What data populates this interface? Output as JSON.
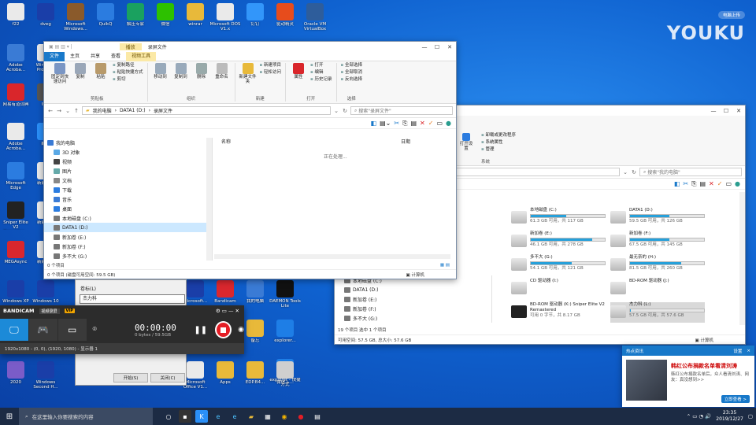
{
  "desktop": {
    "icons": [
      {
        "label": "f22",
        "icon": "document-icon",
        "color": "#eaeaea"
      },
      {
        "label": "dveg",
        "icon": "flag-icon",
        "color": "#1a3ea8"
      },
      {
        "label": "Microsoft Windows...",
        "icon": "package-icon",
        "color": "#8a5a2b"
      },
      {
        "label": "QuikQ",
        "icon": "q-app-icon",
        "color": "#2b7ce0"
      },
      {
        "label": "解压专家",
        "icon": "edge-icon",
        "color": "#1aa15f"
      },
      {
        "label": "微信",
        "icon": "wechat-icon",
        "color": "#2dc100"
      },
      {
        "label": "winrar",
        "icon": "folder-icon",
        "color": "#e8b93a"
      },
      {
        "label": "Microsoft DOS V1.x",
        "icon": "document-icon",
        "color": "#eaeaea"
      },
      {
        "label": "钉钉",
        "icon": "dingtalk-icon",
        "color": "#3296fa"
      },
      {
        "label": "驱动精灵",
        "icon": "driver-app-icon",
        "color": "#e74c1c"
      },
      {
        "label": "Oracle VM VirtualBox",
        "icon": "virtualbox-icon",
        "color": "#2e5d9b"
      },
      {
        "label": "Adobe Acroba...",
        "icon": "pc-icon",
        "color": "#3a7bd5"
      },
      {
        "label": "Windows Profes...",
        "icon": "document-icon",
        "color": "#eaeaea"
      },
      {
        "label": "网易有道词典",
        "icon": "youdao-icon",
        "color": "#d9262b"
      },
      {
        "label": "IMG",
        "icon": "image-icon",
        "color": "#555"
      },
      {
        "label": "Adobe Acroba...",
        "icon": "document-icon",
        "color": "#eaeaea"
      },
      {
        "label": "酷狗",
        "icon": "kugou-icon",
        "color": "#2a8ff7"
      },
      {
        "label": "Microsoft Edge",
        "icon": "edge-icon",
        "color": "#2b7ce0"
      },
      {
        "label": "新建文本",
        "icon": "text-file-icon",
        "color": "#eaeaea"
      },
      {
        "label": "Sniper Elite V2 Remaster...",
        "icon": "game-icon",
        "color": "#222"
      },
      {
        "label": "新建文本",
        "icon": "text-file-icon",
        "color": "#eaeaea"
      },
      {
        "label": "MEGAsync",
        "icon": "mega-icon",
        "color": "#d9272e"
      },
      {
        "label": "新建文本",
        "icon": "text-file-icon",
        "color": "#eaeaea"
      },
      {
        "label": "Windows XP",
        "icon": "flag-icon",
        "color": "#1a3ea8"
      },
      {
        "label": "Windows 10",
        "icon": "flag-icon",
        "color": "#1a3ea8"
      },
      {
        "label": "Microsoft...",
        "icon": "flag-icon",
        "color": "#1a3ea8"
      },
      {
        "label": "Bandicam",
        "icon": "bandicam-icon",
        "color": "#d9272e"
      },
      {
        "label": "我的电脑",
        "icon": "pc-icon",
        "color": "#3a7bd5"
      },
      {
        "label": "DAEMON Tools Lite",
        "icon": "daemon-icon",
        "color": "#111"
      },
      {
        "label": "explorer...",
        "icon": "ie-icon",
        "color": "#1e7ee6"
      },
      {
        "label": "备忘",
        "icon": "folder-icon",
        "color": "#e8b93a"
      },
      {
        "label": "explorer - 快捷方式",
        "icon": "ie-icon",
        "color": "#1e7ee6"
      },
      {
        "label": "2020",
        "icon": "pinwheel-icon",
        "color": "#7a5cc8"
      },
      {
        "label": "Windows Second H...",
        "icon": "flag-icon",
        "color": "#1a3ea8"
      },
      {
        "label": "Microsoft Office V1...",
        "icon": "document-icon",
        "color": "#eaeaea"
      },
      {
        "label": "Apps",
        "icon": "folder-icon",
        "color": "#e8b93a"
      },
      {
        "label": "EDP.B4...",
        "icon": "folder-icon",
        "color": "#e8b93a"
      },
      {
        "label": "微信工...",
        "icon": "tool-icon",
        "color": "#cfcfcf"
      }
    ]
  },
  "youku": {
    "badge": "电脑上传",
    "logo": "YOUKU"
  },
  "explorer_front": {
    "context_tab": "播放",
    "title": "录屏文件",
    "tabs": [
      "文件",
      "主页",
      "共享",
      "查看",
      "视频工具"
    ],
    "ribbon": {
      "clipboard": {
        "name": "剪贴板",
        "pin": "固定到快速访问",
        "copy": "复制",
        "paste": "粘贴",
        "cut": "剪切",
        "copy_path": "复制路径",
        "paste_shortcut": "粘贴快捷方式"
      },
      "organize": {
        "name": "组织",
        "move": "移动到",
        "copyto": "复制到",
        "delete": "删除",
        "rename": "重命名"
      },
      "new": {
        "name": "新建",
        "folder": "新建文件夹",
        "item": "新建项目",
        "easy": "轻松访问"
      },
      "open": {
        "name": "打开",
        "props": "属性",
        "open": "打开",
        "edit": "编辑",
        "history": "历史记录"
      },
      "select": {
        "name": "选择",
        "all": "全部选择",
        "none": "全部取消",
        "invert": "反向选择"
      }
    },
    "breadcrumb": [
      "我的电脑",
      "DATA1 (D:)",
      "录屏文件"
    ],
    "search_placeholder": "搜索\"录屏文件\"",
    "nav_items": [
      "我的电脑",
      "3D 对象",
      "视频",
      "图片",
      "文档",
      "下载",
      "音乐",
      "桌面",
      "本地磁盘 (C:)",
      "DATA1 (D:)",
      "新加卷 (E:)",
      "新加卷 (F:)",
      "多不大 (G:)"
    ],
    "col_name": "名称",
    "col_date": "日期",
    "processing": "正在处理...",
    "status": "0 个项目",
    "status2": "0 个项目 (磁盘可用空间: 59.5 GB)",
    "status_right": "计算机"
  },
  "explorer_back": {
    "ribbon_items": {
      "uninstall": "卸载或更改程序",
      "sysprops": "系统属性",
      "manage": "管理",
      "open_settings": "打开设置",
      "group": "系统"
    },
    "search_placeholder": "搜索\"我的电脑\"",
    "drives": [
      {
        "name": "本地磁盘 (C:)",
        "free": "61.3 GB 可用，共 117 GB",
        "fill": 0.48
      },
      {
        "name": "DATA1 (D:)",
        "free": "59.5 GB 可用，共 126 GB",
        "fill": 0.53
      },
      {
        "name": "新加卷 (E:)",
        "free": "46.1 GB 可用，共 278 GB",
        "fill": 0.83
      },
      {
        "name": "新加卷 (F:)",
        "free": "67.5 GB 可用，共 145 GB",
        "fill": 0.53
      },
      {
        "name": "多不大 (G:)",
        "free": "54.1 GB 可用，共 121 GB",
        "fill": 0.55
      },
      {
        "name": "最无奈的 (H:)",
        "free": "81.5 GB 可用，共 260 GB",
        "fill": 0.69
      },
      {
        "name": "CD 驱动器 (I:)",
        "free": "",
        "fill": 0
      },
      {
        "name": "BD-ROM 驱动器 (J:)",
        "free": "",
        "fill": 0
      },
      {
        "name": "BD-ROM 驱动器 (K:) Sniper Elite V2 Remastered",
        "free": "可用 0 字节，共 8.17 GB",
        "fill": 0
      },
      {
        "name": "杰力科 (L:)",
        "free": "57.5 GB 可用，共 57.6 GB",
        "fill": 0.01
      }
    ],
    "nav_items": [
      "本地磁盘 (C:)",
      "DATA1 (D:)",
      "新加卷 (E:)",
      "新加卷 (F:)",
      "多不大 (G:)"
    ],
    "status": "19 个项目   选中 1 个项目",
    "status2": "可用空间: 57.5 GB, 总大小: 57.6 GB",
    "status_right": "计算机"
  },
  "bandicam": {
    "brand": "BANDICAM",
    "tab": "视频录屏",
    "vip": "VIP",
    "timer": "00:00:00",
    "size": "0 bytes / 59.5GB",
    "resolution": "1920x1080 - (0, 0), (1920, 1080) - 显示器 1"
  },
  "dialog": {
    "label": "卷标(L)",
    "value": "杰力科",
    "start": "开始(S)",
    "close": "关闭(C)"
  },
  "notification": {
    "header": "热点资讯",
    "settings": "设置",
    "close": "×",
    "title": "韩红公布捐款名单看清刘涛",
    "desc": "韩红公布捐款名单后，众人看清刘涛、网友：真没想到>>",
    "more": "立即查看 >"
  },
  "taskbar": {
    "search_placeholder": "在这里输入你要搜索的内容",
    "time": "23:35",
    "date": "2019/12/27"
  }
}
